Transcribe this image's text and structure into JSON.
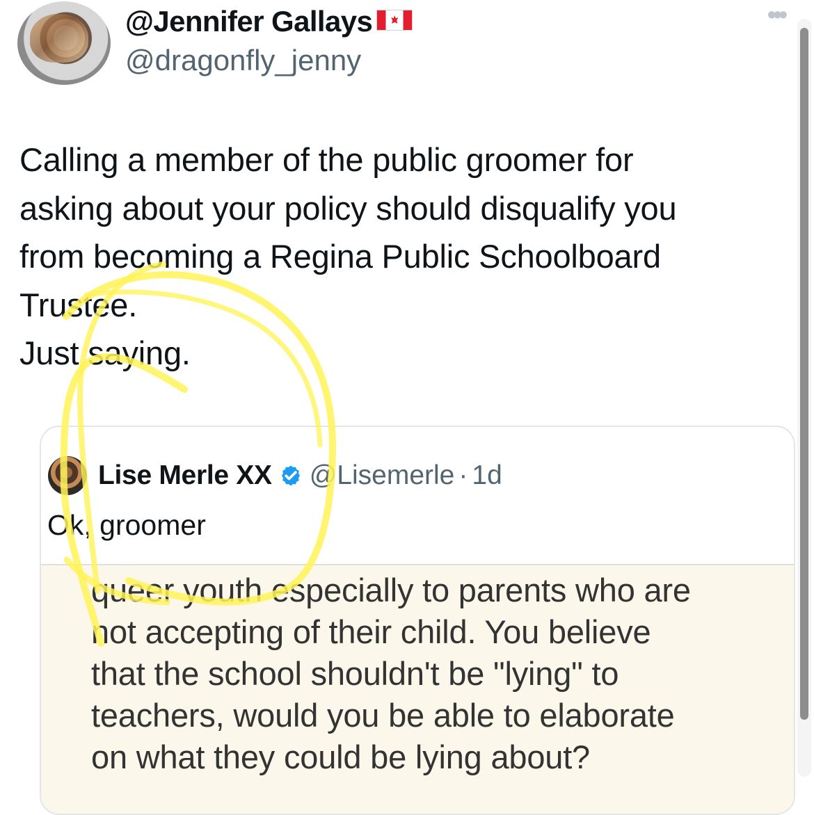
{
  "post": {
    "display_name": "@Jennifer Gallays",
    "handle": "@dragonfly_jenny",
    "text": "Calling a member of the public groomer for\nasking about your policy should disqualify you\nfrom becoming a Regina Public Schoolboard\nTrustee.\nJust saying.",
    "menu_icon": "more-horizontal-icon",
    "flag_icon": "canada-flag-icon"
  },
  "quote": {
    "display_name": "Lise Merle XX",
    "verified_icon": "verified-badge-icon",
    "handle": "@Lisemerle",
    "separator": "·",
    "time": "1d",
    "text": "Ok, groomer",
    "media_text": "queer youth especially to parents who are\nnot accepting of their child.  You believe\nthat the school shouldn't be \"lying\" to\nteachers, would you be able to elaborate\non what they could be lying about?"
  },
  "colors": {
    "primary_text": "#0f1419",
    "secondary_text": "#536471",
    "verified_blue": "#1d9bf0",
    "highlight_yellow": "#fff35a",
    "media_background": "#fbf7ea"
  }
}
